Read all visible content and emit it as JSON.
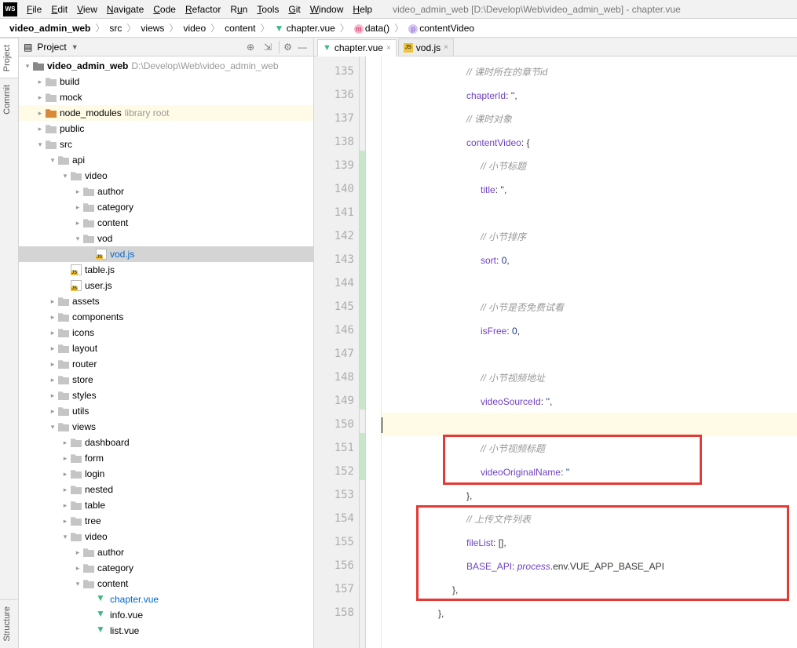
{
  "window_title": "video_admin_web [D:\\Develop\\Web\\video_admin_web] - chapter.vue",
  "menu": [
    "File",
    "Edit",
    "View",
    "Navigate",
    "Code",
    "Refactor",
    "Run",
    "Tools",
    "Git",
    "Window",
    "Help"
  ],
  "breadcrumbs": {
    "root": "video_admin_web",
    "parts": [
      "src",
      "views",
      "video",
      "content"
    ],
    "file": "chapter.vue",
    "func": "data()",
    "prop": "contentVideo"
  },
  "left_rail": {
    "project": "Project",
    "commit": "Commit",
    "structure": "Structure"
  },
  "project_panel": {
    "title": "Project",
    "root": {
      "name": "video_admin_web",
      "path": "D:\\Develop\\Web\\video_admin_web"
    },
    "node_modules_note": "library root",
    "folders": {
      "build": "build",
      "mock": "mock",
      "node_modules": "node_modules",
      "public": "public",
      "src": "src",
      "api": "api",
      "video": "video",
      "author": "author",
      "category": "category",
      "content": "content",
      "vod": "vod",
      "assets": "assets",
      "components": "components",
      "icons": "icons",
      "layout": "layout",
      "router": "router",
      "store": "store",
      "styles": "styles",
      "utils": "utils",
      "views": "views",
      "dashboard": "dashboard",
      "form": "form",
      "login": "login",
      "nested": "nested",
      "table": "table",
      "tree": "tree"
    },
    "files": {
      "vodjs": "vod.js",
      "tablejs": "table.js",
      "userjs": "user.js",
      "chaptervue": "chapter.vue",
      "infovue": "info.vue",
      "listvue": "list.vue"
    }
  },
  "tabs": {
    "chapter": "chapter.vue",
    "vod": "vod.js"
  },
  "lines": {
    "start": 135,
    "end": 158
  },
  "code": {
    "l135": "// 课时所在的章节id",
    "l136k": "chapterId",
    "l136v": "''",
    "l137": "// 课时对象",
    "l138k": "contentVideo",
    "l138v": "{",
    "l139": "// 小节标题",
    "l140k": "title",
    "l140v": "''",
    "l142": "// 小节排序",
    "l143k": "sort",
    "l143v": "0",
    "l145": "// 小节是否免费试看",
    "l146k": "isFree",
    "l146v": "0",
    "l148": "// 小节视频地址",
    "l149k": "videoSourceId",
    "l149v": "''",
    "l151": "// 小节视频标题",
    "l152k": "videoOriginalName",
    "l152v": "''",
    "l153": "},",
    "l154": "// 上传文件列表",
    "l155k": "fileList",
    "l155v": "[]",
    "l156k": "BASE_API",
    "l156a": "process",
    "l156b": ".env.VUE_APP_BASE_API",
    "l157": "},",
    "l158": "},"
  }
}
